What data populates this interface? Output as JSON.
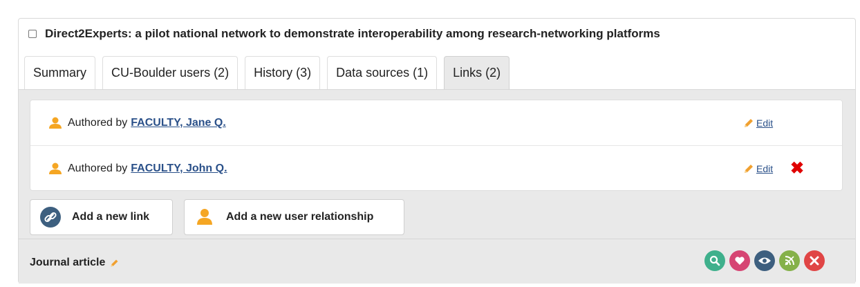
{
  "record": {
    "title": "Direct2Experts: a pilot national network to demonstrate interoperability among research-networking platforms",
    "type_label": "Journal article"
  },
  "tabs": [
    {
      "label": "Summary",
      "active": false
    },
    {
      "label": "CU-Boulder users (2)",
      "active": false
    },
    {
      "label": "History (3)",
      "active": false
    },
    {
      "label": "Data sources (1)",
      "active": false
    },
    {
      "label": "Links (2)",
      "active": true
    }
  ],
  "links": [
    {
      "prefix": "Authored by",
      "person": "FACULTY, Jane Q.",
      "edit_label": "Edit",
      "deletable": false
    },
    {
      "prefix": "Authored by",
      "person": "FACULTY, John Q.",
      "edit_label": "Edit",
      "deletable": true
    }
  ],
  "buttons": {
    "add_link": "Add a new link",
    "add_user_relationship": "Add a new user relationship"
  },
  "actions": [
    {
      "icon": "search-icon",
      "color": "#3fb08c"
    },
    {
      "icon": "heart-icon",
      "color": "#d64573"
    },
    {
      "icon": "eye-icon",
      "color": "#3d5f7f"
    },
    {
      "icon": "rss-off-icon",
      "color": "#85b14a"
    },
    {
      "icon": "close-icon",
      "color": "#e04545"
    }
  ],
  "colors": {
    "link": "#2a5089",
    "user_icon": "#f5a623",
    "delete": "#e00000"
  }
}
